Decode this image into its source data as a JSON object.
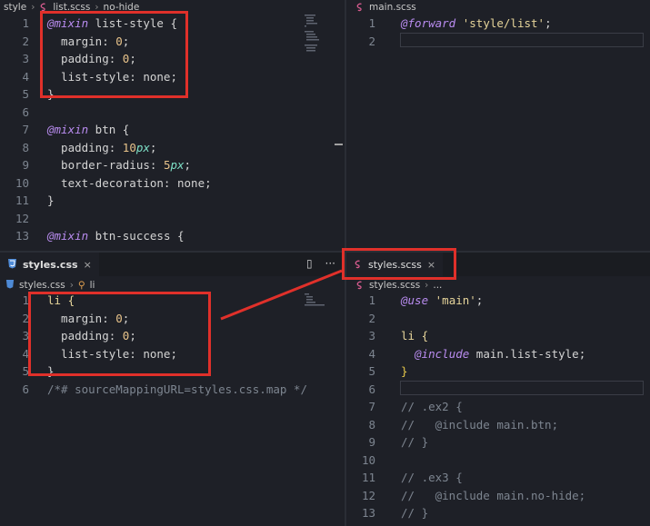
{
  "top_left": {
    "breadcrumb": [
      "style",
      "list.scss",
      "no-hide"
    ],
    "lines": [
      {
        "n": "1",
        "segs": [
          {
            "t": "@mixin",
            "c": "kw"
          },
          {
            "t": " list-style {",
            "c": "prop"
          }
        ]
      },
      {
        "n": "2",
        "segs": [
          {
            "t": "  margin: ",
            "c": "prop"
          },
          {
            "t": "0",
            "c": "num"
          },
          {
            "t": ";",
            "c": "prop"
          }
        ]
      },
      {
        "n": "3",
        "segs": [
          {
            "t": "  padding: ",
            "c": "prop"
          },
          {
            "t": "0",
            "c": "num"
          },
          {
            "t": ";",
            "c": "prop"
          }
        ]
      },
      {
        "n": "4",
        "segs": [
          {
            "t": "  list-style: none;",
            "c": "prop"
          }
        ]
      },
      {
        "n": "5",
        "segs": [
          {
            "t": "}",
            "c": "prop"
          }
        ]
      },
      {
        "n": "6",
        "segs": []
      },
      {
        "n": "7",
        "segs": [
          {
            "t": "@mixin",
            "c": "kw"
          },
          {
            "t": " btn {",
            "c": "prop"
          }
        ]
      },
      {
        "n": "8",
        "segs": [
          {
            "t": "  padding: ",
            "c": "prop"
          },
          {
            "t": "10",
            "c": "num"
          },
          {
            "t": "px",
            "c": "unit"
          },
          {
            "t": ";",
            "c": "prop"
          }
        ]
      },
      {
        "n": "9",
        "segs": [
          {
            "t": "  border-radius: ",
            "c": "prop"
          },
          {
            "t": "5",
            "c": "num"
          },
          {
            "t": "px",
            "c": "unit"
          },
          {
            "t": ";",
            "c": "prop"
          }
        ]
      },
      {
        "n": "10",
        "segs": [
          {
            "t": "  text-decoration: none;",
            "c": "prop"
          }
        ]
      },
      {
        "n": "11",
        "segs": [
          {
            "t": "}",
            "c": "prop"
          }
        ]
      },
      {
        "n": "12",
        "segs": []
      },
      {
        "n": "13",
        "segs": [
          {
            "t": "@mixin",
            "c": "kw"
          },
          {
            "t": " btn-success {",
            "c": "prop"
          }
        ]
      }
    ]
  },
  "top_right": {
    "breadcrumb": [
      "main.scss"
    ],
    "lines": [
      {
        "n": "1",
        "segs": [
          {
            "t": "@forward",
            "c": "kw"
          },
          {
            "t": " ",
            "c": "prop"
          },
          {
            "t": "'style/list'",
            "c": "str"
          },
          {
            "t": ";",
            "c": "prop"
          }
        ]
      },
      {
        "n": "2",
        "segs": []
      }
    ]
  },
  "bottom_left": {
    "tab_label": "styles.css",
    "tab_close": "×",
    "actions": {
      "split": "▯",
      "more": "···"
    },
    "breadcrumb": [
      "styles.css",
      "li"
    ],
    "lines": [
      {
        "n": "1",
        "segs": [
          {
            "t": "li {",
            "c": "sel"
          }
        ]
      },
      {
        "n": "2",
        "segs": [
          {
            "t": "  margin: ",
            "c": "prop"
          },
          {
            "t": "0",
            "c": "num"
          },
          {
            "t": ";",
            "c": "prop"
          }
        ]
      },
      {
        "n": "3",
        "segs": [
          {
            "t": "  padding: ",
            "c": "prop"
          },
          {
            "t": "0",
            "c": "num"
          },
          {
            "t": ";",
            "c": "prop"
          }
        ]
      },
      {
        "n": "4",
        "segs": [
          {
            "t": "  list-style: none;",
            "c": "prop"
          }
        ]
      },
      {
        "n": "5",
        "segs": [
          {
            "t": "}",
            "c": "prop"
          }
        ]
      },
      {
        "n": "6",
        "segs": [
          {
            "t": "/*# sourceMappingURL=styles.css.map */",
            "c": "com"
          }
        ]
      }
    ]
  },
  "bottom_right": {
    "tab_label": "styles.scss",
    "tab_close": "×",
    "breadcrumb": [
      "styles.scss",
      "..."
    ],
    "lines": [
      {
        "n": "1",
        "segs": [
          {
            "t": "@use",
            "c": "kw"
          },
          {
            "t": " ",
            "c": "prop"
          },
          {
            "t": "'main'",
            "c": "str"
          },
          {
            "t": ";",
            "c": "prop"
          }
        ]
      },
      {
        "n": "2",
        "segs": []
      },
      {
        "n": "3",
        "segs": [
          {
            "t": "li {",
            "c": "sel"
          }
        ]
      },
      {
        "n": "4",
        "segs": [
          {
            "t": "  ",
            "c": "prop"
          },
          {
            "t": "@include",
            "c": "kw"
          },
          {
            "t": " main.list-style;",
            "c": "prop"
          }
        ]
      },
      {
        "n": "5",
        "segs": [
          {
            "t": "}",
            "c": "brk"
          }
        ]
      },
      {
        "n": "6",
        "segs": []
      },
      {
        "n": "7",
        "segs": [
          {
            "t": "// .ex2 {",
            "c": "com"
          }
        ]
      },
      {
        "n": "8",
        "segs": [
          {
            "t": "//   @include main.btn;",
            "c": "com"
          }
        ]
      },
      {
        "n": "9",
        "segs": [
          {
            "t": "// }",
            "c": "com"
          }
        ]
      },
      {
        "n": "10",
        "segs": []
      },
      {
        "n": "11",
        "segs": [
          {
            "t": "// .ex3 {",
            "c": "com"
          }
        ]
      },
      {
        "n": "12",
        "segs": [
          {
            "t": "//   @include main.no-hide;",
            "c": "com"
          }
        ]
      },
      {
        "n": "13",
        "segs": [
          {
            "t": "// }",
            "c": "com"
          }
        ]
      }
    ]
  },
  "colors": {
    "annotation_red": "#e0302a",
    "scss_icon": "#d65b8e",
    "css_icon": "#4e8ad6"
  }
}
